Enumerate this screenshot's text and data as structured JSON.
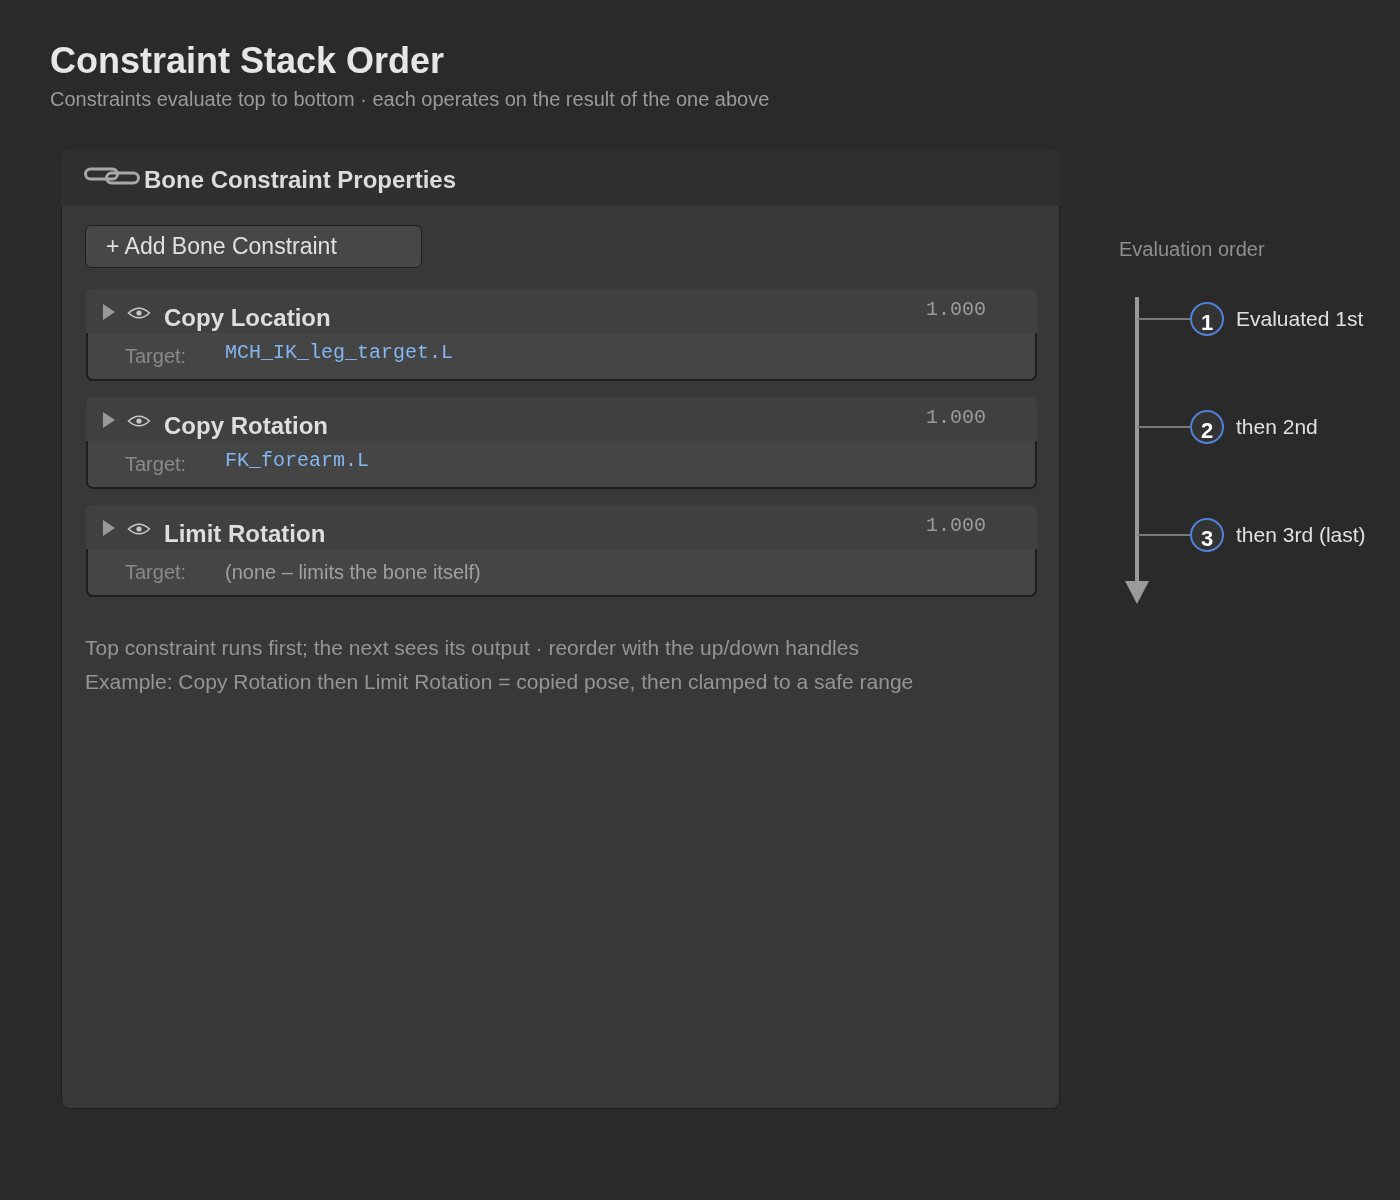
{
  "title": "Constraint Stack Order",
  "subtitle": "Constraints evaluate top to bottom · each operates on the result of the one above",
  "panel": {
    "title": "Bone Constraint Properties",
    "add_button": "+ Add Bone Constraint",
    "constraints": [
      {
        "name": "Copy Location",
        "influence": "1.000",
        "target_label": "Target:",
        "target": "MCH_IK_leg_target.L",
        "kind": "bone"
      },
      {
        "name": "Copy Rotation",
        "influence": "1.000",
        "target_label": "Target:",
        "target": "FK_forearm.L",
        "kind": "bone"
      },
      {
        "name": "Limit Rotation",
        "influence": "1.000",
        "target_label": "Target:",
        "target": "(none – limits the bone itself)",
        "kind": "none"
      }
    ],
    "notes": [
      "Top constraint runs first; the next sees its output · reorder with the up/down handles",
      "Example: Copy Rotation then Limit Rotation = copied pose, then clamped to a safe range"
    ]
  },
  "evaluation": {
    "title": "Evaluation order",
    "steps": [
      {
        "number": "1",
        "label": "Evaluated 1st"
      },
      {
        "number": "2",
        "label": "then 2nd"
      },
      {
        "number": "3",
        "label": "then 3rd (last)"
      }
    ]
  }
}
